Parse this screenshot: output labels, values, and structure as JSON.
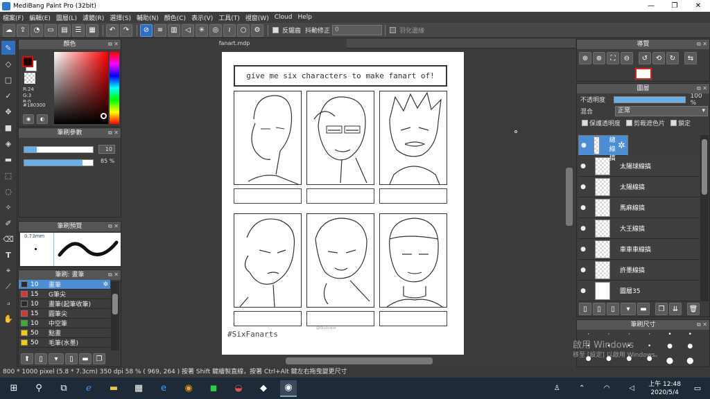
{
  "window": {
    "title": "MediBang Paint Pro (32bit)"
  },
  "menu": [
    "檔案(F)",
    "編輯(E)",
    "圖層(L)",
    "濾鏡(R)",
    "選擇(S)",
    "輔助(N)",
    "顏色(C)",
    "表示(V)",
    "工具(T)",
    "視窗(W)",
    "Cloud",
    "Help"
  ],
  "toolbar": {
    "antialias_label": "反鋸齒",
    "correction_label": "抖動修正",
    "correction_value": "0",
    "wrap_label": "羽化邊緣"
  },
  "color_panel": {
    "title": "顏色",
    "r": "R:24",
    "g": "G:3",
    "b": "B:0",
    "hex": "#180300",
    "primary": "#180300",
    "secondary": "#ffffff"
  },
  "brush_params": {
    "title": "筆刷參數",
    "size": "10",
    "opacity": "85 %",
    "opacity_frac": 0.85
  },
  "brush_preview": {
    "title": "筆刷預覽",
    "size_label": "0.73mm"
  },
  "brush_list": {
    "title": "筆刷: 畫筆",
    "items": [
      {
        "size": "10",
        "name": "畫筆",
        "color": "#2b2b2b",
        "selected": true
      },
      {
        "size": "15",
        "name": "G筆尖",
        "color": "#e03030",
        "selected": false
      },
      {
        "size": "10",
        "name": "畫筆(起筆收筆)",
        "color": "#2b2b2b",
        "selected": false
      },
      {
        "size": "15",
        "name": "圓筆尖",
        "color": "#e03030",
        "selected": false
      },
      {
        "size": "10",
        "name": "中空筆",
        "color": "#2fb52f",
        "selected": false
      },
      {
        "size": "50",
        "name": "點畫",
        "color": "#f2d000",
        "selected": false
      },
      {
        "size": "50",
        "name": "毛筆(水墨)",
        "color": "#f2d000",
        "selected": false
      }
    ]
  },
  "document": {
    "tab": "fanart.mdp",
    "heading": "give me six characters to make fanart of!",
    "hashtag": "#SixFanarts",
    "credit": "@illustrator"
  },
  "navigator": {
    "title": "導覽"
  },
  "layers": {
    "title": "圖層",
    "opacity_label": "不透明度",
    "opacity_value": "100 %",
    "blend_label": "混合",
    "blend_value": "正常",
    "protect_label": "保護透明度",
    "clip_label": "剪裁遮色片",
    "lock_label": "鎖定",
    "items": [
      {
        "name": "賀總線搞",
        "selected": true
      },
      {
        "name": "太陽球線搞",
        "selected": false
      },
      {
        "name": "太陽線搞",
        "selected": false
      },
      {
        "name": "馬麻線搞",
        "selected": false
      },
      {
        "name": "大王線搞",
        "selected": false
      },
      {
        "name": "車車車線搞",
        "selected": false
      },
      {
        "name": "許墨線搞",
        "selected": false
      },
      {
        "name": "圖層35",
        "selected": false
      }
    ]
  },
  "brush_size_panel": {
    "title": "筆刷尺寸",
    "watermark1": "啟用 Windows",
    "watermark2": "移至 [設定] 以啟用 Windows。"
  },
  "status": {
    "text": "800 * 1000 pixel  (5.8 * 7.3cm)  350 dpi  58 %  ( 969, 264 )  按著 Shift 鍵繪製直線，按著 Ctrl+Alt 鍵左右拖曳變更尺寸"
  },
  "taskbar": {
    "time": "上午 12:48",
    "date": "2020/5/4"
  }
}
